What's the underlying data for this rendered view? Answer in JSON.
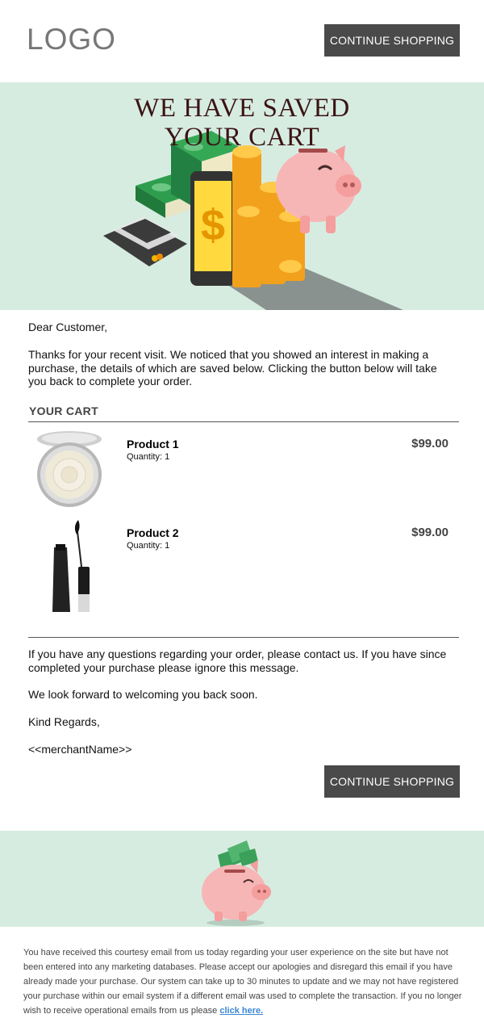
{
  "header": {
    "logo_text": "LOGO",
    "continue_label": "CONTINUE SHOPPING"
  },
  "hero": {
    "title_line1": "WE HAVE SAVED",
    "title_line2": "YOUR CART"
  },
  "message": {
    "greeting": "Dear Customer,",
    "intro": "Thanks for your recent visit. We noticed that you showed an interest in making a purchase, the details of which are saved below. Clicking the button below will take you back to complete your order.",
    "outro": "If you have any questions regarding your order, please contact us. If you have since completed your purchase please ignore this message.",
    "look_forward": "We look forward to welcoming you back soon.",
    "regards": "Kind Regards,",
    "merchant": "<<merchantName>>"
  },
  "cart": {
    "label": "YOUR CART",
    "items": [
      {
        "name": "Product 1",
        "quantity": "Quantity: 1",
        "price": "$99.00",
        "thumb_icon": "compact-powder-icon"
      },
      {
        "name": "Product 2",
        "quantity": "Quantity: 1",
        "price": "$99.00",
        "thumb_icon": "mascara-icon"
      }
    ]
  },
  "footer": {
    "continue_label": "CONTINUE SHOPPING",
    "legal_text": "You have received this courtesy email from us today regarding your user experience on the site but have not been entered into any marketing databases. Please accept our apologies and disregard this email if you have already made your purchase. Our system can take up to 30 minutes to update and we may not have registered your purchase within our email system if a different email was used to complete the transaction. If you no longer wish to receive operational emails from us please",
    "link_text": "click here."
  },
  "colors": {
    "accent_band": "#d7ece1",
    "button_bg": "#4a4a4a",
    "title_color": "#3a1414",
    "link_color": "#3b87d6"
  }
}
